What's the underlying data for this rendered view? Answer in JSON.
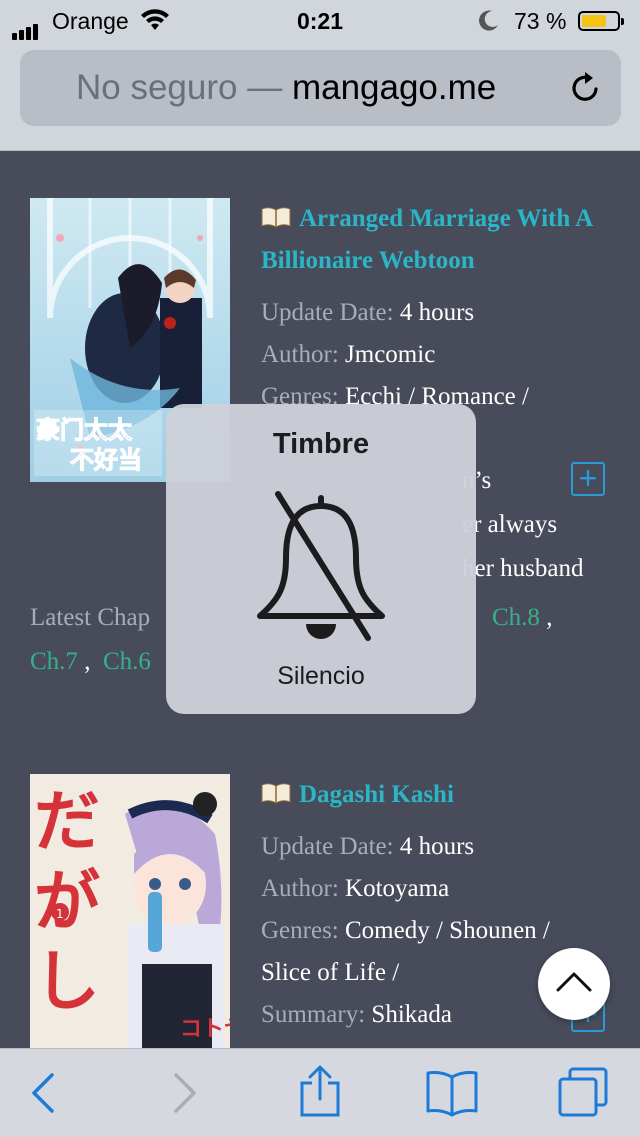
{
  "status": {
    "carrier": "Orange",
    "time": "0:21",
    "battery_percent": "73 %",
    "battery_level": 0.73
  },
  "urlbar": {
    "insecure_label": "No seguro —",
    "domain": "mangago.me"
  },
  "entries": [
    {
      "title": "Arranged Marriage With A Billionaire Webtoon",
      "update_label": "Update Date:",
      "update_value": "4 hours",
      "author_label": "Author:",
      "author_value": "Jmcomic",
      "genres_label": "Genres:",
      "genres_value": "Ecchi / Romance /",
      "summary_visible": [
        "n’s",
        "er always",
        "her husband"
      ],
      "latest_label": "Latest Chap",
      "chapters": [
        "Ch.8",
        "Ch.7",
        "Ch.6"
      ]
    },
    {
      "title": "Dagashi Kashi",
      "update_label": "Update Date:",
      "update_value": "4 hours",
      "author_label": "Author:",
      "author_value": "Kotoyama",
      "genres_label": "Genres:",
      "genres_value": "Comedy / Shounen /",
      "genres_value2": "Slice of Life /",
      "summary_label": "Summary:",
      "summary_value": "Shikada"
    }
  ],
  "hud": {
    "title": "Timbre",
    "state": "Silencio"
  },
  "icons": {
    "book": "open-book-icon",
    "add": "plus-icon",
    "bell": "bell-muted-icon",
    "up": "chevron-up-icon"
  },
  "colors": {
    "background": "#474b5a",
    "title": "#2ab6c6",
    "chapter": "#34b28a",
    "label": "#a9adb7"
  }
}
